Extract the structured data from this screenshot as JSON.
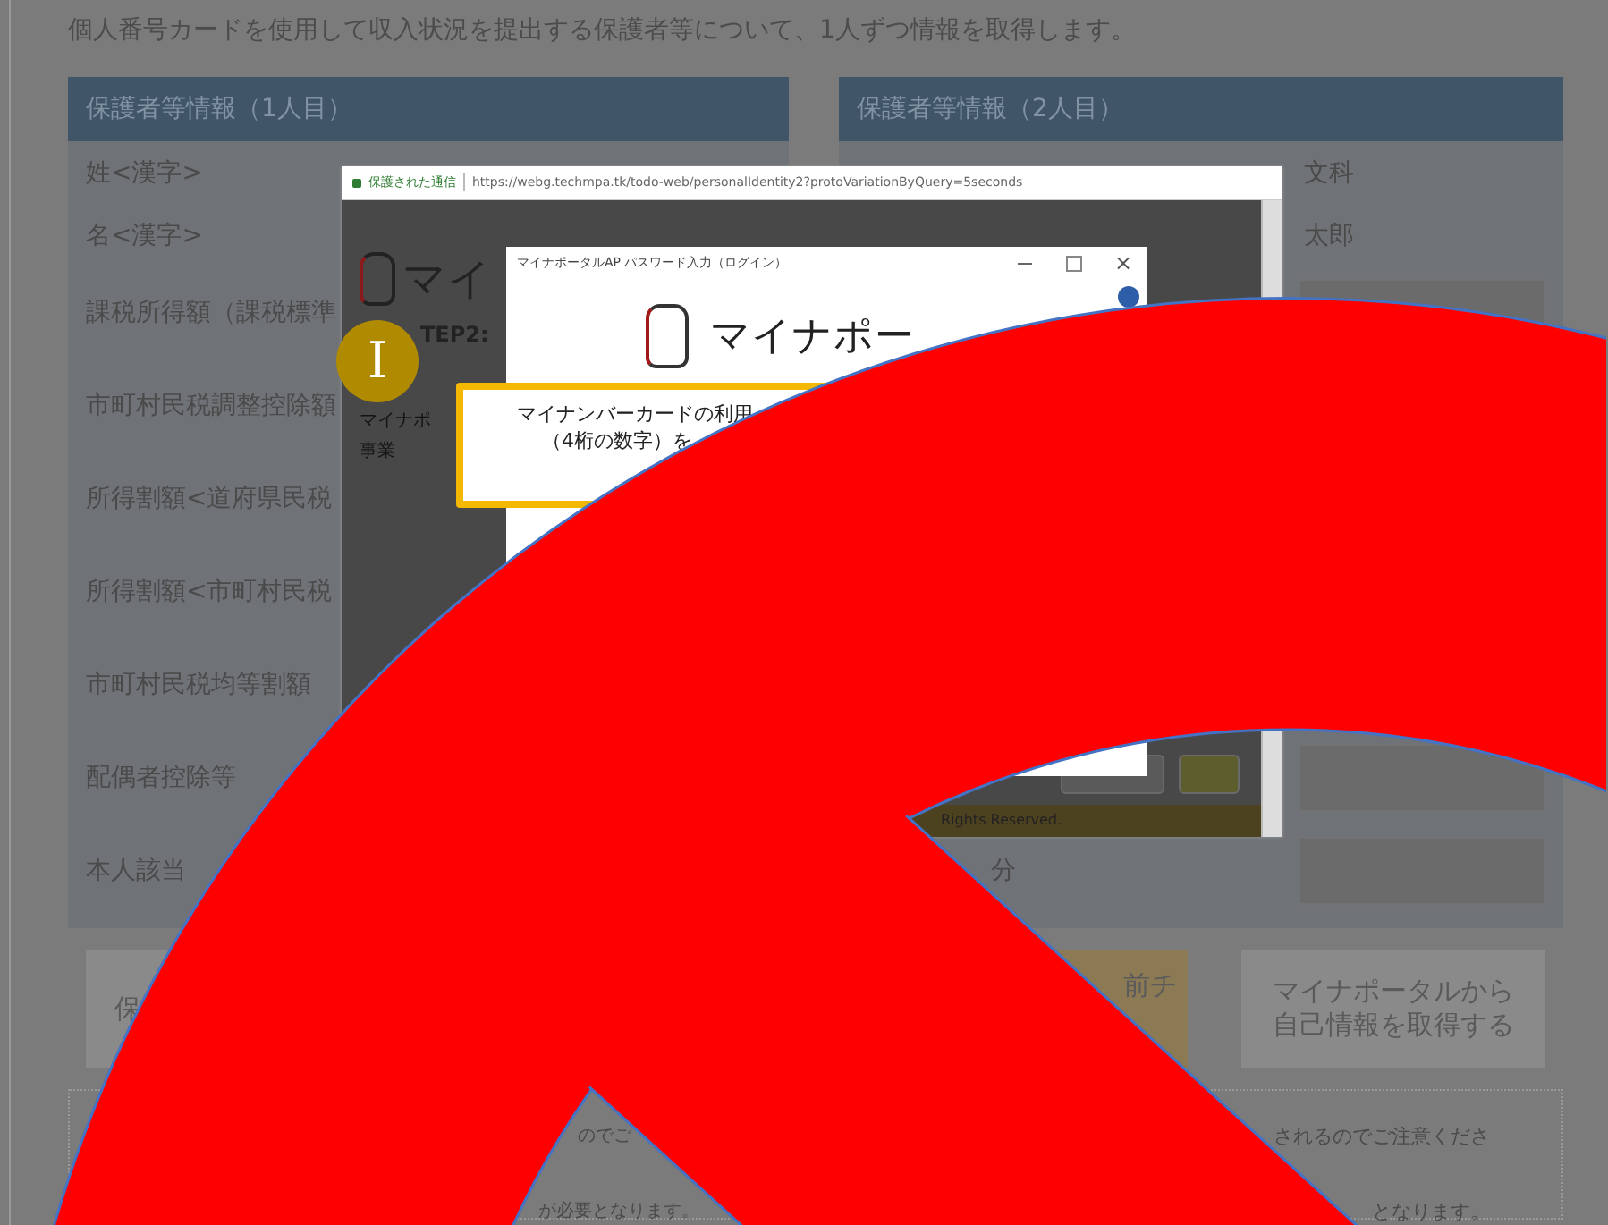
{
  "intro": "個人番号カードを使用して収入状況を提出する保護者等について、1人ずつ情報を取得します。",
  "panels": [
    {
      "title": "保護者等情報（1人目）",
      "rows": [
        {
          "label": "姓<漢字>"
        },
        {
          "label": "名<漢字>"
        },
        {
          "label": "課税所得額（課税標準"
        },
        {
          "label": "市町村民税調整控除額"
        },
        {
          "label": "所得割額<道府県民税"
        },
        {
          "label": "所得割額<市町村民税"
        },
        {
          "label": "市町村民税均等割額"
        },
        {
          "label": "配偶者控除等"
        },
        {
          "label": "本人該当"
        }
      ]
    },
    {
      "title": "保護者等情報（2人目）",
      "rows": [
        {
          "value": "文科"
        },
        {
          "value": "太郎"
        },
        {
          "field": true
        },
        {},
        {},
        {},
        {},
        {
          "field": true
        },
        {
          "label": "分",
          "field": true
        }
      ]
    }
  ],
  "buttons": [
    {
      "label": "保",
      "kind": "plain"
    },
    {
      "label": "前チ",
      "kind": "accent"
    },
    {
      "label": "マイナポータルから自己情報を取得する",
      "kind": "plain"
    }
  ],
  "notes": [
    "のでご",
    "されるのでご注意くださ",
    "が必要となります。",
    "となります。"
  ],
  "popup": {
    "secure_label": "保護された通信",
    "url": "https://webg.techmpa.tk/todo-web/personalIdentity2?protoVariationByQuery=5seconds",
    "logo_text": "マイ",
    "step": "TEP2:",
    "side_text": [
      "マイナポ",
      "事業"
    ],
    "footer": "Rights Reserved.",
    "dialog": {
      "title": "マイナポータルAP パスワード入力（ログイン）",
      "close_glyph": "×",
      "logo_text": "マイナポー",
      "message": [
        "マイナンバーカードの利用",
        "（4桁の数字）を"
      ]
    }
  },
  "badge": "I"
}
